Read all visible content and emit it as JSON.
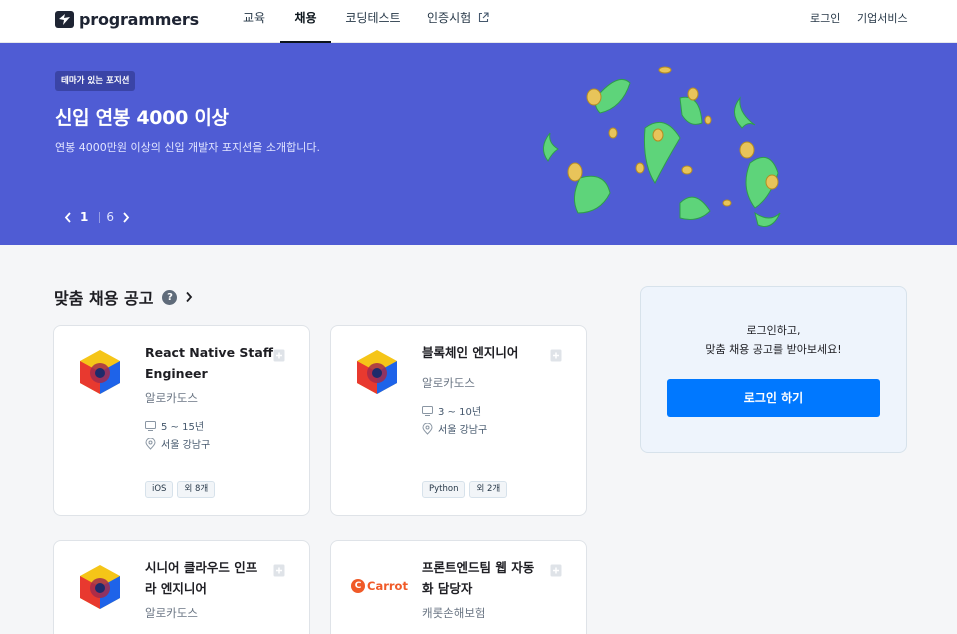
{
  "header": {
    "logo_text": "programmers",
    "nav": [
      {
        "label": "교육"
      },
      {
        "label": "채용"
      },
      {
        "label": "코딩테스트"
      },
      {
        "label": "인증시험"
      }
    ],
    "login_label": "로그인",
    "business_label": "기업서비스"
  },
  "banner": {
    "tag": "테마가 있는 포지션",
    "title": "신입 연봉 4000 이상",
    "description": "연봉 4000만원 이상의 신입 개발자 포지션을 소개합니다.",
    "current_page": "1",
    "total_pages": "6",
    "background_color": "#4f5cd4"
  },
  "section": {
    "title": "맞춤 채용 공고",
    "help_symbol": "?"
  },
  "jobs": [
    {
      "title_line1": "React Native Staff",
      "title_line2": "Engineer",
      "company": "알로카도스",
      "experience": "5 ~ 15년",
      "location": "서울 강남구",
      "tags": [
        "iOS",
        "외 8개"
      ]
    },
    {
      "title_line1": "블록체인 엔지니어",
      "title_line2": "",
      "company": "알로카도스",
      "experience": "3 ~ 10년",
      "location": "서울 강남구",
      "tags": [
        "Python",
        "외 2개"
      ]
    },
    {
      "title_line1": "시니어 클라우드 인프",
      "title_line2": "라 엔지니어",
      "company": "알로카도스"
    },
    {
      "title_line1": "프론트엔드팀 웹 자동",
      "title_line2": "화 담당자",
      "company": "캐롯손해보험",
      "logo_text": "Carrot",
      "logo_letter": "C"
    }
  ],
  "login_box": {
    "line1": "로그인하고,",
    "line2": "맞춤 채용 공고를 받아보세요!",
    "button_label": "로그인 하기",
    "button_color": "#0078ff"
  }
}
